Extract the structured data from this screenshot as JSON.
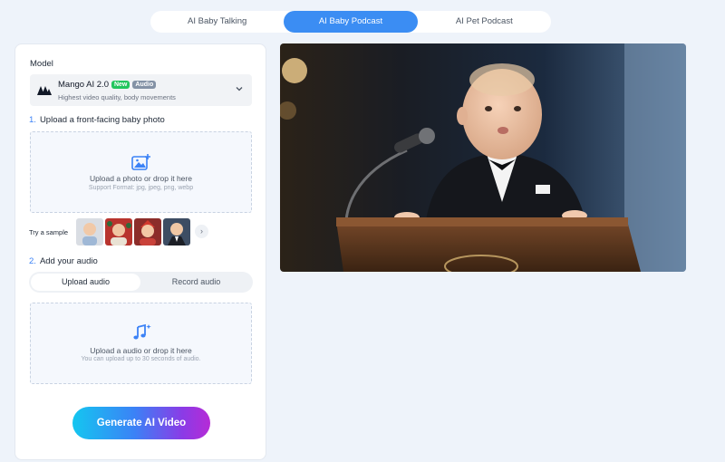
{
  "tabs": [
    {
      "label": "AI Baby Talking",
      "active": false
    },
    {
      "label": "AI Baby Podcast",
      "active": true
    },
    {
      "label": "AI Pet Podcast",
      "active": false
    }
  ],
  "model_section": {
    "label": "Model",
    "name": "Mango AI 2.0",
    "badge_new": "New",
    "badge_audio": "Audio",
    "description": "Highest video quality, body movements",
    "logo_icon": "mango-logo-icon",
    "chevron_icon": "chevron-down-icon"
  },
  "step1": {
    "number": "1.",
    "title": "Upload a front-facing baby photo",
    "dropzone_main": "Upload a photo or drop it here",
    "dropzone_sub": "Support Format: jpg, jpeg, png, webp",
    "icon": "image-upload-icon"
  },
  "samples": {
    "label": "Try a sample",
    "count": 4,
    "next_icon": "chevron-right-icon"
  },
  "step2": {
    "number": "2.",
    "title": "Add your audio",
    "tab_upload": "Upload audio",
    "tab_record": "Record audio",
    "active_tab": "Upload audio",
    "dropzone_main": "Upload a audio or drop it here",
    "dropzone_sub": "You can upload up to 30 seconds of audio.",
    "icon": "music-note-icon"
  },
  "generate_button": "Generate AI Video",
  "colors": {
    "accent": "#3b8df3",
    "badge_new": "#22c55e",
    "badge_audio": "#8492a6",
    "step_number": "#3b82f6"
  }
}
